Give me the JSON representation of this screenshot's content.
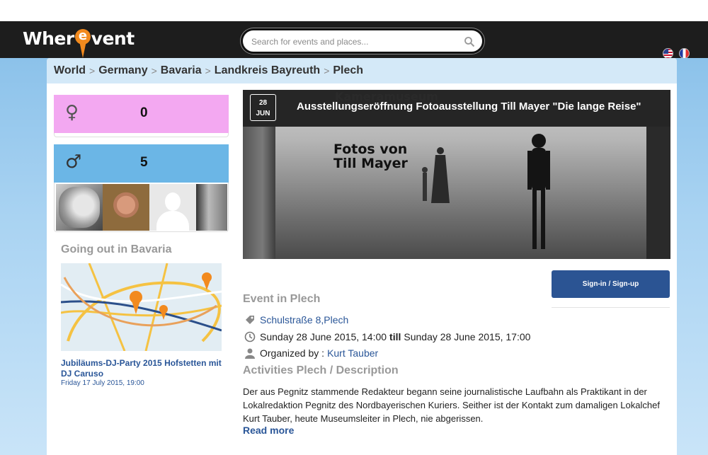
{
  "header": {
    "logo_prefix": "Wher",
    "logo_pin_letter": "e",
    "logo_suffix": "vent",
    "search_placeholder": "Search for events and places...",
    "flags": [
      "us-flag-icon",
      "fr-flag-icon"
    ]
  },
  "breadcrumb": [
    "World",
    "Germany",
    "Bavaria",
    "Landkreis Bayreuth",
    "Plech"
  ],
  "attendance": {
    "female_symbol": "♀",
    "female_count": "0",
    "male_symbol": "♂",
    "male_count": "5",
    "female_color": "#f3a8f1",
    "male_color": "#6bb6e6"
  },
  "sidebar": {
    "going_out_title": "Going out in Bavaria",
    "related_event_title": "Jubiläums-DJ-Party 2015 Hofstetten mit DJ Caruso",
    "related_event_date": "Friday 17 July 2015, 19:00"
  },
  "event": {
    "date_day": "28",
    "date_month": "JUN",
    "title": "Ausstellungseröffnung Fotoausstellung Till Mayer \"Die lange Reise\"",
    "banner_headline_1": "Kameramuseum",
    "banner_headline_2": "Fotos von",
    "banner_headline_3": "Till Mayer",
    "signin_label": "Sign-in / Sign-up",
    "event_in_title": "Event in Plech",
    "address": "Schulstraße 8,Plech",
    "time_start": "Sunday 28 June 2015, 14:00",
    "time_sep": "till",
    "time_end": "Sunday 28 June 2015, 17:00",
    "organized_label": "Organized by :",
    "organizer": "Kurt Tauber",
    "activities_title": "Activities Plech / Description",
    "description": "Der aus Pegnitz stammende Redakteur begann seine journalistische Laufbahn als Praktikant in der Lokalredaktion Pegnitz des Nordbayerischen Kuriers. Seither ist der Kontakt zum damaligen Lokalchef Kurt Tauber, heute Museumsleiter in Plech, nie abgerissen.",
    "read_more": "Read more"
  },
  "colors": {
    "header_bg": "#1d1d1d",
    "accent_orange": "#f28a1e",
    "link_blue": "#2a5698",
    "button_blue": "#2b5493"
  }
}
